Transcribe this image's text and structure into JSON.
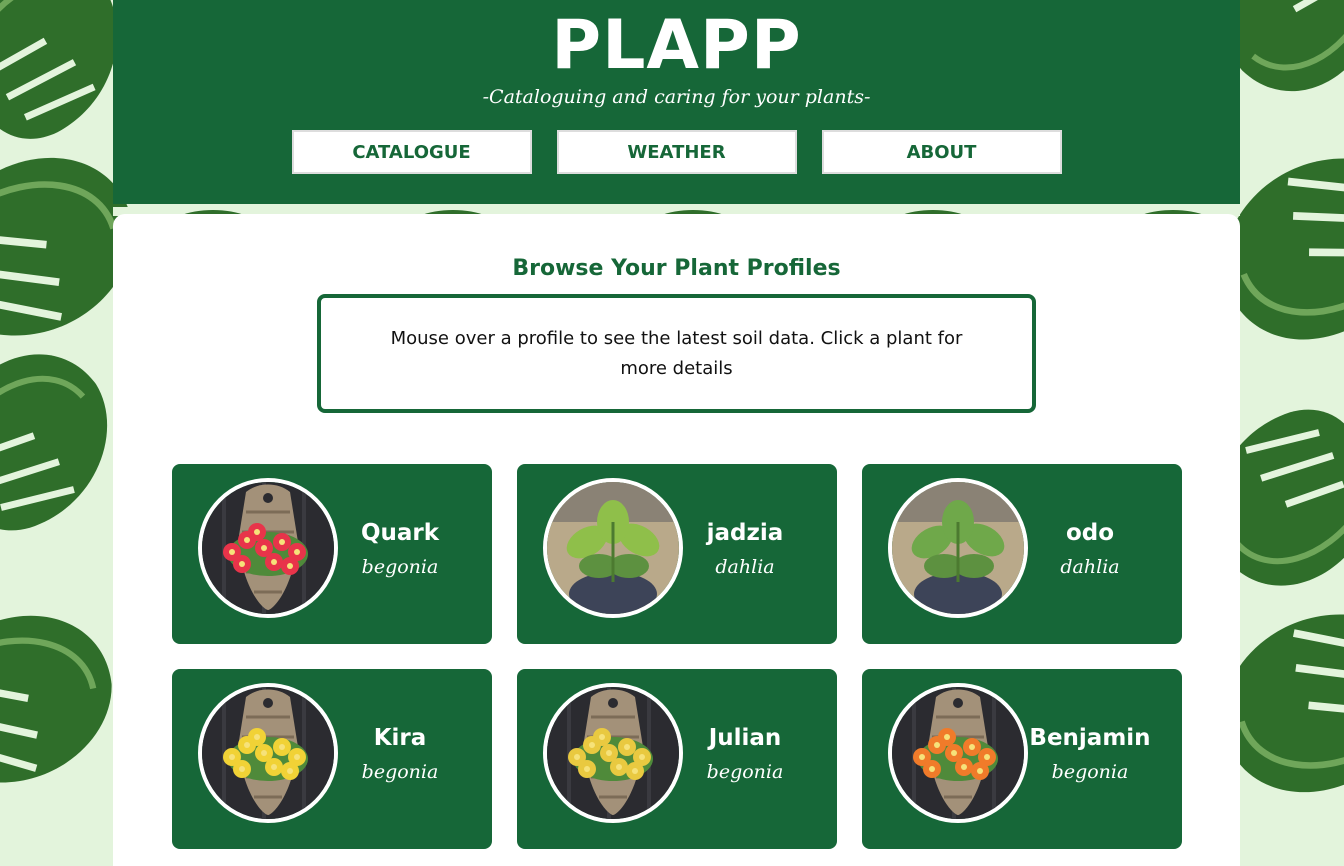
{
  "header": {
    "title": "PLAPP",
    "tagline": "-Cataloguing and caring for your plants-"
  },
  "nav": [
    {
      "label": "CATALOGUE"
    },
    {
      "label": "WEATHER"
    },
    {
      "label": "ABOUT"
    }
  ],
  "main": {
    "heading": "Browse Your Plant Profiles",
    "instructions": "Mouse over a profile to see the latest soil data. Click a plant for more details"
  },
  "plants": [
    {
      "name": "Quark",
      "species": "begonia",
      "flower_color": "#e8344a",
      "image": "hanging-basket-photo"
    },
    {
      "name": "jadzia",
      "species": "dahlia",
      "flower_color": "#8fbf4a",
      "image": "potted-plant-photo"
    },
    {
      "name": "odo",
      "species": "dahlia",
      "flower_color": "#6fa84a",
      "image": "potted-plant-photo"
    },
    {
      "name": "Kira",
      "species": "begonia",
      "flower_color": "#f1d236",
      "image": "hanging-basket-photo"
    },
    {
      "name": "Julian",
      "species": "begonia",
      "flower_color": "#e9c940",
      "image": "hanging-basket-photo"
    },
    {
      "name": "Benjamin",
      "species": "begonia",
      "flower_color": "#f07b2a",
      "image": "hanging-basket-photo"
    }
  ],
  "colors": {
    "brand_green": "#166738",
    "page_background": "#e3f4dc",
    "leaf_dark": "#2f6e2a",
    "leaf_light": "#6fa65a"
  },
  "icons": [
    "monstera-leaf-icon"
  ]
}
